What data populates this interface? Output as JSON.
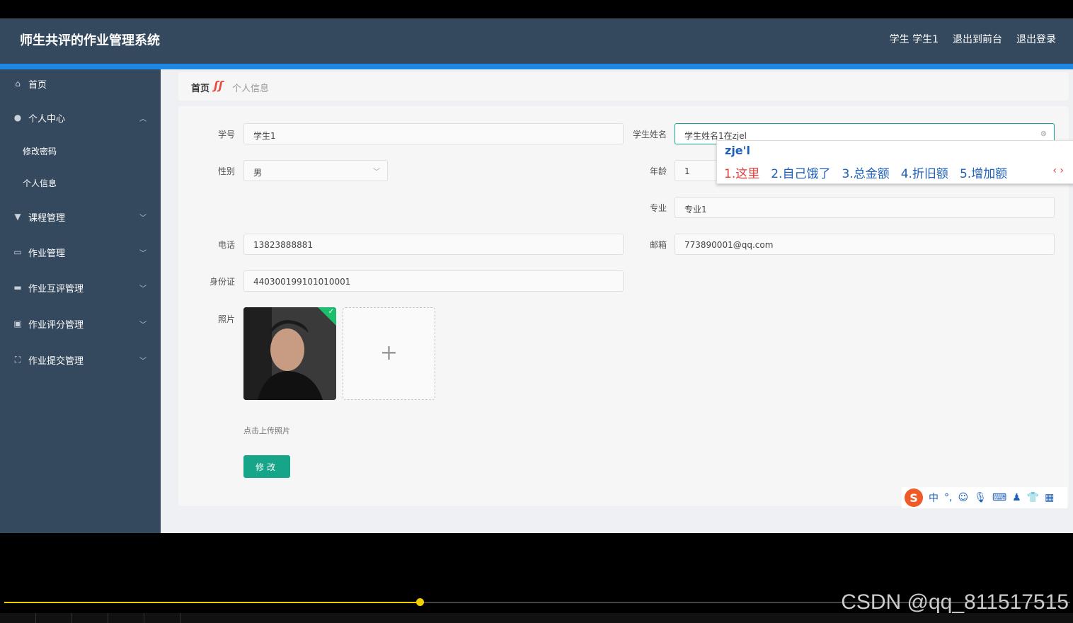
{
  "header": {
    "title": "师生共评的作业管理系统",
    "user": "学生 学生1",
    "back_front": "退出到前台",
    "logout": "退出登录"
  },
  "sidebar": {
    "items": [
      {
        "label": "首页",
        "icon": "home-icon"
      },
      {
        "label": "个人中心",
        "icon": "user-icon"
      },
      {
        "label": "课程管理",
        "icon": "course-icon"
      },
      {
        "label": "作业管理",
        "icon": "chat-icon"
      },
      {
        "label": "作业互评管理",
        "icon": "briefcase-icon"
      },
      {
        "label": "作业评分管理",
        "icon": "clipboard-icon"
      },
      {
        "label": "作业提交管理",
        "icon": "frame-icon"
      }
    ],
    "subitems": [
      "修改密码",
      "个人信息"
    ]
  },
  "breadcrumb": {
    "home": "首页",
    "current": "个人信息"
  },
  "form": {
    "xuehao_label": "学号",
    "xuehao_value": "学生1",
    "name_label": "学生姓名",
    "name_value": "学生姓名1在zjel",
    "gender_label": "性别",
    "gender_value": "男",
    "age_label": "年龄",
    "age_value": "1",
    "major_label": "专业",
    "major_value": "专业1",
    "phone_label": "电话",
    "phone_value": "13823888881",
    "email_label": "邮箱",
    "email_value": "773890001@qq.com",
    "id_label": "身份证",
    "id_value": "440300199101010001",
    "photo_label": "照片",
    "upload_hint": "点击上传照片",
    "submit_label": "修改"
  },
  "ime": {
    "composition": "zje'l",
    "candidates": [
      "1.这里",
      "2.自己饿了",
      "3.总金额",
      "4.折旧额",
      "5.增加额"
    ],
    "toolbar_lang": "中"
  },
  "player": {
    "progress": 0.39,
    "watermark": "CSDN @qq_811517515"
  },
  "colors": {
    "header": "#34495e",
    "accent": "#17a589",
    "blue_line": "#1e88e5"
  }
}
